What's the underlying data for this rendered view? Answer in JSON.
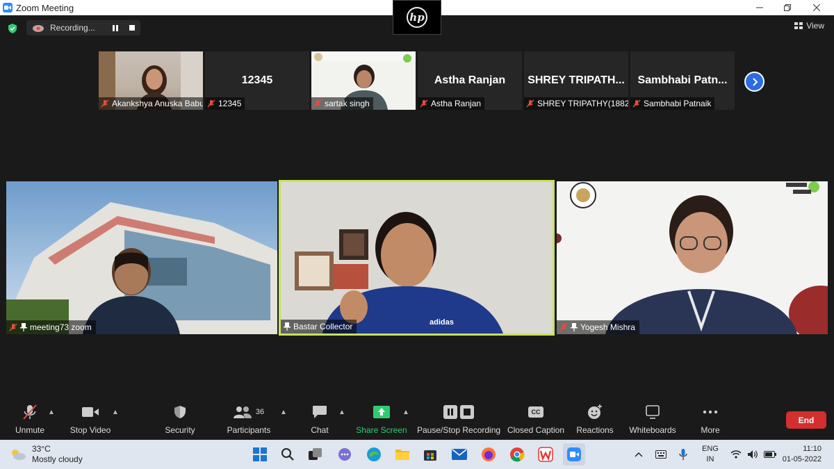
{
  "window": {
    "title": "Zoom Meeting",
    "accent": "#2d8cff"
  },
  "recording": {
    "status_text": "Recording..."
  },
  "view": {
    "label": "View"
  },
  "thumbnails": [
    {
      "name": "Akankshya Anuska Babu",
      "big_name": "",
      "muted": true
    },
    {
      "name": "12345",
      "big_name": "12345",
      "muted": true
    },
    {
      "name": "sartak singh",
      "big_name": "",
      "muted": true
    },
    {
      "name": "Astha Ranjan",
      "big_name": "Astha Ranjan",
      "muted": true
    },
    {
      "name": "SHREY TRIPATHY(1882...",
      "big_name": "SHREY  TRIPATH...",
      "muted": true
    },
    {
      "name": "Sambhabi Patnaik",
      "big_name": "Sambhabi  Patn...",
      "muted": true
    }
  ],
  "tiles": [
    {
      "name": "meeting73 zoom",
      "active": false
    },
    {
      "name": "Bastar Collector",
      "active": true
    },
    {
      "name": "Yogesh Mishra",
      "active": false
    }
  ],
  "toolbar": {
    "unmute": "Unmute",
    "stop_video": "Stop Video",
    "security": "Security",
    "participants": "Participants",
    "participants_count": "36",
    "chat": "Chat",
    "share_screen": "Share Screen",
    "pause_stop_recording": "Pause/Stop Recording",
    "closed_caption": "Closed Caption",
    "cc_icon_text": "CC",
    "reactions": "Reactions",
    "whiteboards": "Whiteboards",
    "more": "More",
    "end": "End",
    "end_color": "#d32f2f",
    "share_color": "#2ecc71"
  },
  "taskbar": {
    "temperature": "33°C",
    "weather": "Mostly cloudy",
    "lang_1": "ENG",
    "lang_2": "IN",
    "time": "11:10",
    "date": "01-05-2022"
  }
}
